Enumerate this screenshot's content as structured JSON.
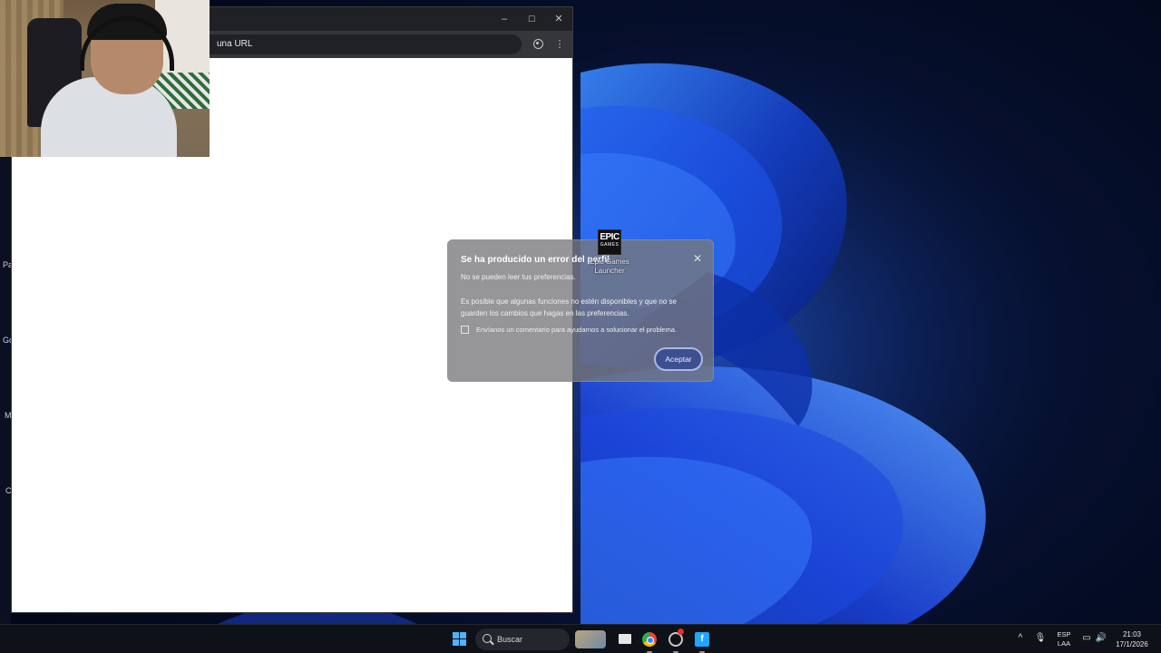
{
  "browser": {
    "omnibox_text": "una URL",
    "window_controls": {
      "minimize": "–",
      "maximize": "☐",
      "close": "✕"
    },
    "menu_icon": "⋮"
  },
  "desktop": {
    "side_labels": [
      "Pa",
      "Go",
      "M",
      "C"
    ],
    "icon": {
      "logo_main": "EPIC",
      "logo_sub": "GAMES",
      "label": "Epic Games Launcher"
    }
  },
  "dialog": {
    "title": "Se ha producido un error del perfil",
    "close_glyph": "✕",
    "subtitle": "No se pueden leer tus preferencias.",
    "body": "Es posible que algunas funciones no estén disponibles y que no se guarden los cambios que hagas en las preferencias.",
    "checkbox_label": "Envíanos un comentario para ayudarnos a solucionar el problema.",
    "checkbox_checked": false,
    "accept_label": "Aceptar"
  },
  "taskbar": {
    "search_placeholder": "Buscar",
    "apps": [
      "weather-widget",
      "task-view",
      "chrome",
      "screen-recorder",
      "blue-app"
    ],
    "blue_app_glyph": "f",
    "tray": {
      "chevron": "^",
      "mic": "🎙",
      "lang_top": "ESP",
      "lang_bottom": "LAA",
      "network": "▭",
      "volume": "🔊",
      "time": "21:03",
      "date": "17/1/2026"
    }
  },
  "colors": {
    "accent_button": "#3d4f8f",
    "windows_blue": "#4fb3ff",
    "titlebar": "#202124"
  }
}
